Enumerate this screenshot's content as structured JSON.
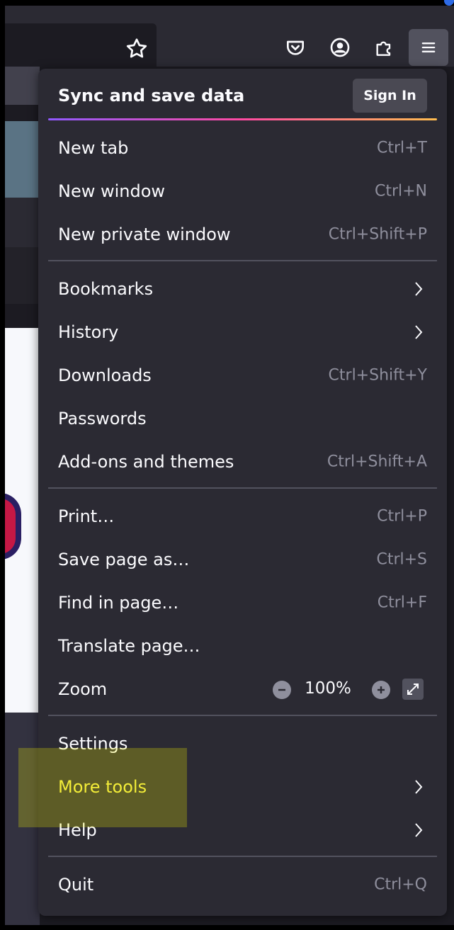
{
  "toolbar": {
    "bookmark_star": "star-icon",
    "pocket": "pocket-icon",
    "account": "account-icon",
    "extensions": "extensions-icon",
    "menu": "hamburger-menu-icon"
  },
  "menu": {
    "header_title": "Sync and save data",
    "sign_in_label": "Sign In",
    "groups": [
      [
        {
          "label": "New tab",
          "shortcut": "Ctrl+T"
        },
        {
          "label": "New window",
          "shortcut": "Ctrl+N"
        },
        {
          "label": "New private window",
          "shortcut": "Ctrl+Shift+P"
        }
      ],
      [
        {
          "label": "Bookmarks",
          "submenu": true
        },
        {
          "label": "History",
          "submenu": true
        },
        {
          "label": "Downloads",
          "shortcut": "Ctrl+Shift+Y"
        },
        {
          "label": "Passwords"
        },
        {
          "label": "Add-ons and themes",
          "shortcut": "Ctrl+Shift+A"
        }
      ],
      [
        {
          "label": "Print…",
          "shortcut": "Ctrl+P"
        },
        {
          "label": "Save page as…",
          "shortcut": "Ctrl+S"
        },
        {
          "label": "Find in page…",
          "shortcut": "Ctrl+F"
        },
        {
          "label": "Translate page…"
        },
        {
          "label": "Zoom",
          "zoom_value": "100%"
        }
      ],
      [
        {
          "label": "Settings"
        },
        {
          "label": "More tools",
          "submenu": true,
          "highlighted": true
        },
        {
          "label": "Help",
          "submenu": true
        }
      ],
      [
        {
          "label": "Quit",
          "shortcut": "Ctrl+Q"
        }
      ]
    ]
  },
  "colors": {
    "panel_bg": "#2b2a33",
    "text": "#fbfbfe",
    "shortcut_text": "#8f8f9d",
    "highlight": "#ffff00"
  }
}
